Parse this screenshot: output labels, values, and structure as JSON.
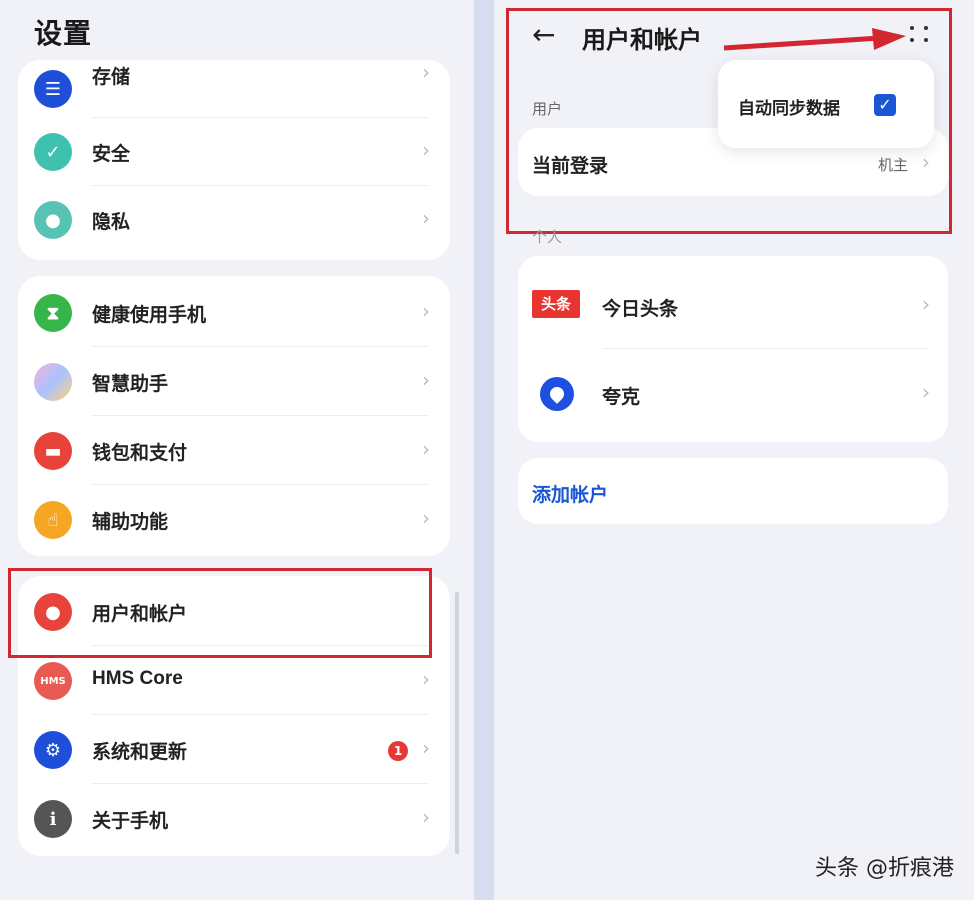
{
  "left": {
    "title": "设置",
    "groups": [
      {
        "items": [
          {
            "label": "存储",
            "icon": "storage-icon"
          },
          {
            "label": "安全",
            "icon": "shield-icon"
          },
          {
            "label": "隐私",
            "icon": "privacy-icon"
          }
        ]
      },
      {
        "items": [
          {
            "label": "健康使用手机",
            "icon": "hourglass-icon"
          },
          {
            "label": "智慧助手",
            "icon": "assistant-icon"
          },
          {
            "label": "钱包和支付",
            "icon": "wallet-icon"
          },
          {
            "label": "辅助功能",
            "icon": "hand-icon"
          }
        ]
      },
      {
        "items": [
          {
            "label": "用户和帐户",
            "icon": "user-icon"
          },
          {
            "label": "HMS Core",
            "icon": "hms-icon",
            "icon_text": "HMS"
          },
          {
            "label": "系统和更新",
            "icon": "gear-icon",
            "badge": "1"
          },
          {
            "label": "关于手机",
            "icon": "info-icon",
            "icon_text": "i"
          }
        ]
      }
    ]
  },
  "right": {
    "title": "用户和帐户",
    "section_user": "用户",
    "current_login": {
      "label": "当前登录",
      "value": "机主"
    },
    "section_personal": "个人",
    "accounts": [
      {
        "label": "今日头条",
        "logo_text": "头条"
      },
      {
        "label": "夸克"
      }
    ],
    "add_account": "添加帐户",
    "popup": {
      "label": "自动同步数据",
      "checked": true,
      "check_mark": "✓"
    }
  },
  "watermark": "头条 @折痕港",
  "colors": {
    "highlight_red": "#d32630",
    "link_blue": "#1a56d6",
    "checkbox_blue": "#1a56d6",
    "badge_red": "#e53935"
  }
}
